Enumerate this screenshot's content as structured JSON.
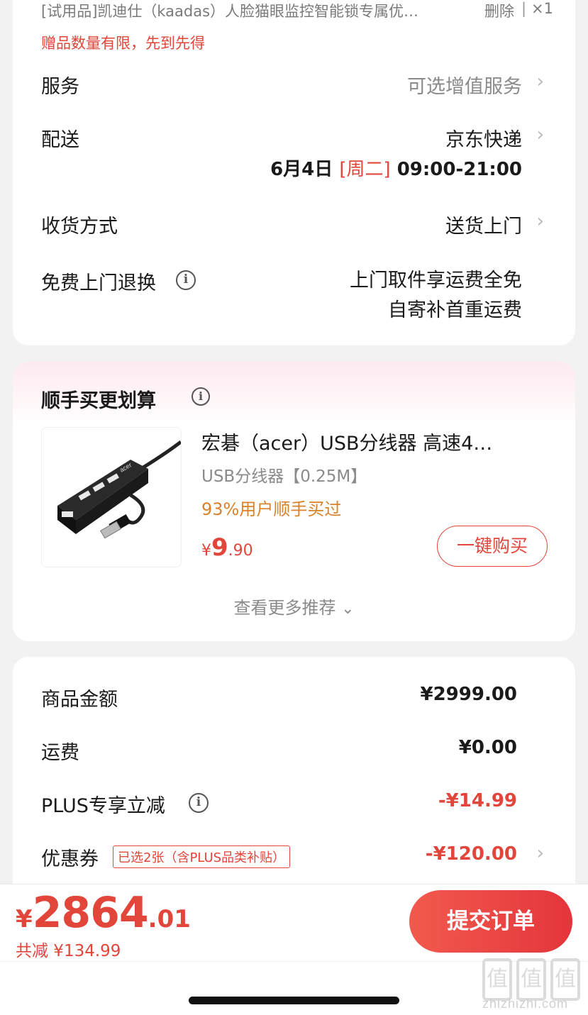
{
  "top_item": {
    "title": "[试用品]凯迪仕（kaadas）人脸猫眼监控智能锁专属优…",
    "delete_label": "删除",
    "separator": "|",
    "quantity": "×1",
    "gift_note": "赠品数量有限，先到先得"
  },
  "service": {
    "label": "服务",
    "value": "可选增值服务"
  },
  "delivery": {
    "label": "配送",
    "carrier": "京东快递",
    "date": "6月4日",
    "weekday": "[周二]",
    "time_window": "09:00-21:00"
  },
  "receive": {
    "label": "收货方式",
    "value": "送货上门"
  },
  "return": {
    "label": "免费上门退换",
    "line1": "上门取件享运费全免",
    "line2": "自寄补首重运费"
  },
  "recommend": {
    "title": "顺手买更划算",
    "product": {
      "name": "宏碁（acer）USB分线器 高速4…",
      "spec": "USB分线器【0.25M】",
      "stat": "93%用户顺手买过",
      "price_symbol": "¥",
      "price_int": "9",
      "price_dec": ".90",
      "buy_label": "一键购买",
      "image_brand": "acer"
    },
    "more_label": "查看更多推荐"
  },
  "summary": {
    "rows": [
      {
        "label": "商品金额",
        "value": "¥2999.00"
      },
      {
        "label": "运费",
        "value": "¥0.00"
      },
      {
        "label": "PLUS专享立减",
        "value": "-¥14.99"
      },
      {
        "label": "优惠券",
        "value": "-¥120.00",
        "tag": "已选2张（含PLUS品类补贴）"
      }
    ]
  },
  "footer": {
    "price_symbol": "¥",
    "price_int": "2864",
    "price_dec": ".01",
    "saved": "共减 ¥134.99",
    "submit_label": "提交订单"
  },
  "watermark": {
    "domain": "zhizhizhi.com",
    "glyph": "值"
  },
  "colors": {
    "accent": "#e2453a",
    "stat_orange": "#d9822b",
    "gray": "#8a8a8a"
  },
  "icons": {
    "chevron": "›",
    "info": "i",
    "chevron_down": "⌄"
  }
}
